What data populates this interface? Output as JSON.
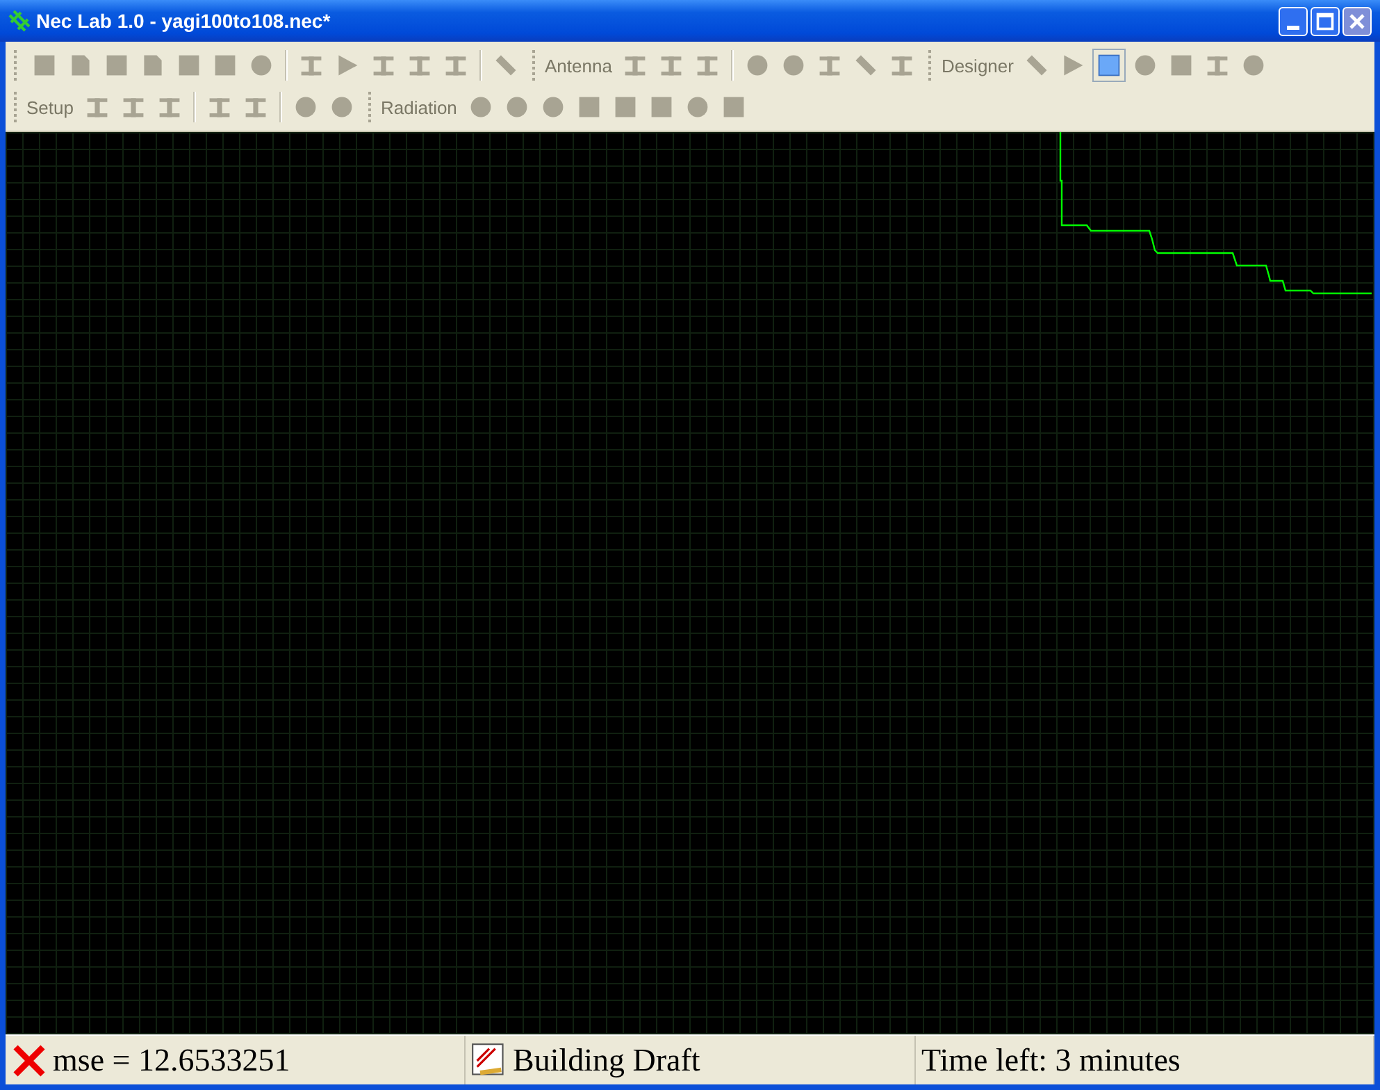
{
  "window": {
    "title": "Nec Lab 1.0 - yagi100to108.nec*"
  },
  "toolbars": [
    [
      {
        "buttons": [
          {
            "kind": "square",
            "selected": false
          },
          {
            "kind": "page",
            "selected": false
          },
          {
            "kind": "square",
            "selected": false
          },
          {
            "kind": "page",
            "selected": false
          },
          {
            "kind": "square",
            "selected": false
          },
          {
            "kind": "square",
            "selected": false
          },
          {
            "kind": "circle",
            "selected": false
          }
        ]
      },
      {
        "buttons": [
          {
            "kind": "bars",
            "selected": false
          },
          {
            "kind": "triangle",
            "selected": false
          },
          {
            "kind": "bars",
            "selected": false
          },
          {
            "kind": "bars",
            "selected": false
          },
          {
            "kind": "bars",
            "selected": false
          }
        ]
      },
      {
        "buttons": [
          {
            "kind": "slash",
            "selected": false
          }
        ]
      },
      {
        "label": "Antenna",
        "buttons": [
          {
            "kind": "bars",
            "selected": false
          },
          {
            "kind": "bars",
            "selected": false
          },
          {
            "kind": "bars",
            "selected": false
          }
        ]
      },
      {
        "buttons": [
          {
            "kind": "circle",
            "selected": false
          },
          {
            "kind": "circle",
            "selected": false
          },
          {
            "kind": "bars",
            "selected": false
          },
          {
            "kind": "slash",
            "selected": false
          },
          {
            "kind": "bars",
            "selected": false
          }
        ]
      },
      {
        "label": "Designer",
        "buttons": [
          {
            "kind": "slash",
            "selected": false
          },
          {
            "kind": "triangle",
            "selected": false
          },
          {
            "kind": "square",
            "selected": true
          },
          {
            "kind": "circle",
            "selected": false
          },
          {
            "kind": "square",
            "selected": false
          },
          {
            "kind": "bars",
            "selected": false
          },
          {
            "kind": "circle",
            "selected": false
          }
        ]
      }
    ],
    [
      {
        "label": "Setup",
        "buttons": [
          {
            "kind": "bars",
            "selected": false
          },
          {
            "kind": "bars",
            "selected": false
          },
          {
            "kind": "bars",
            "selected": false
          }
        ]
      },
      {
        "buttons": [
          {
            "kind": "bars",
            "selected": false
          },
          {
            "kind": "bars",
            "selected": false
          }
        ]
      },
      {
        "buttons": [
          {
            "kind": "circle",
            "selected": false
          },
          {
            "kind": "circle",
            "selected": false
          }
        ]
      },
      {
        "label": "Radiation",
        "buttons": [
          {
            "kind": "circle",
            "selected": false
          },
          {
            "kind": "circle",
            "selected": false
          },
          {
            "kind": "circle",
            "selected": false
          },
          {
            "kind": "square",
            "selected": false
          },
          {
            "kind": "square",
            "selected": false
          },
          {
            "kind": "square",
            "selected": false
          },
          {
            "kind": "circle",
            "selected": false
          },
          {
            "kind": "square",
            "selected": false
          }
        ]
      }
    ]
  ],
  "status_bar": [
    {
      "kind": "error",
      "text": "mse = 12.6533251"
    },
    {
      "kind": "draft",
      "text": "Building Draft"
    },
    {
      "kind": "plain",
      "text": "Time left:  3 minutes"
    }
  ]
}
